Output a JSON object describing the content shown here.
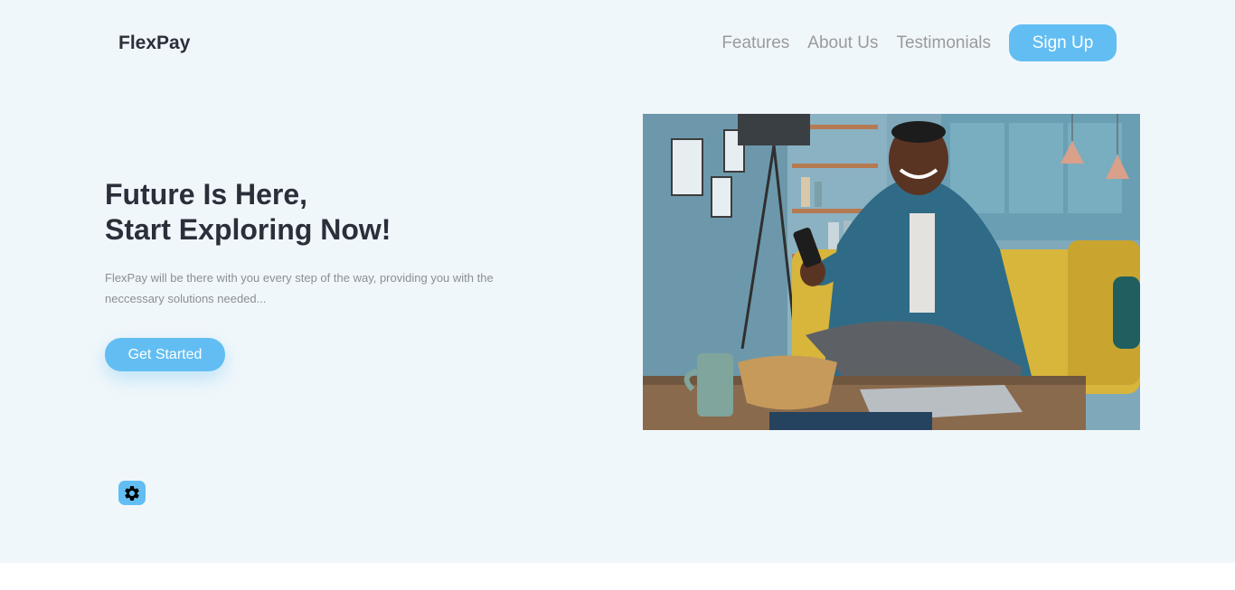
{
  "brand": {
    "name": "FlexPay"
  },
  "nav": {
    "links": [
      "Features",
      "About Us",
      "Testimonials"
    ],
    "signup_label": "Sign Up"
  },
  "hero": {
    "headline_line1": "Future Is Here,",
    "headline_line2": "Start Exploring Now!",
    "description": "FlexPay will be there with you every step of the way, providing you with the neccessary solutions needed...",
    "cta_label": "Get Started",
    "image_icon": "photo-man-with-phone-on-sofa"
  },
  "widgets": {
    "settings_icon": "gear-icon"
  },
  "colors": {
    "accent": "#62bef2",
    "hero_bg": "#f0f7fb",
    "heading": "#2b2f3a",
    "nav_text": "#9a9a9a",
    "body_text": "#8a8f97"
  }
}
